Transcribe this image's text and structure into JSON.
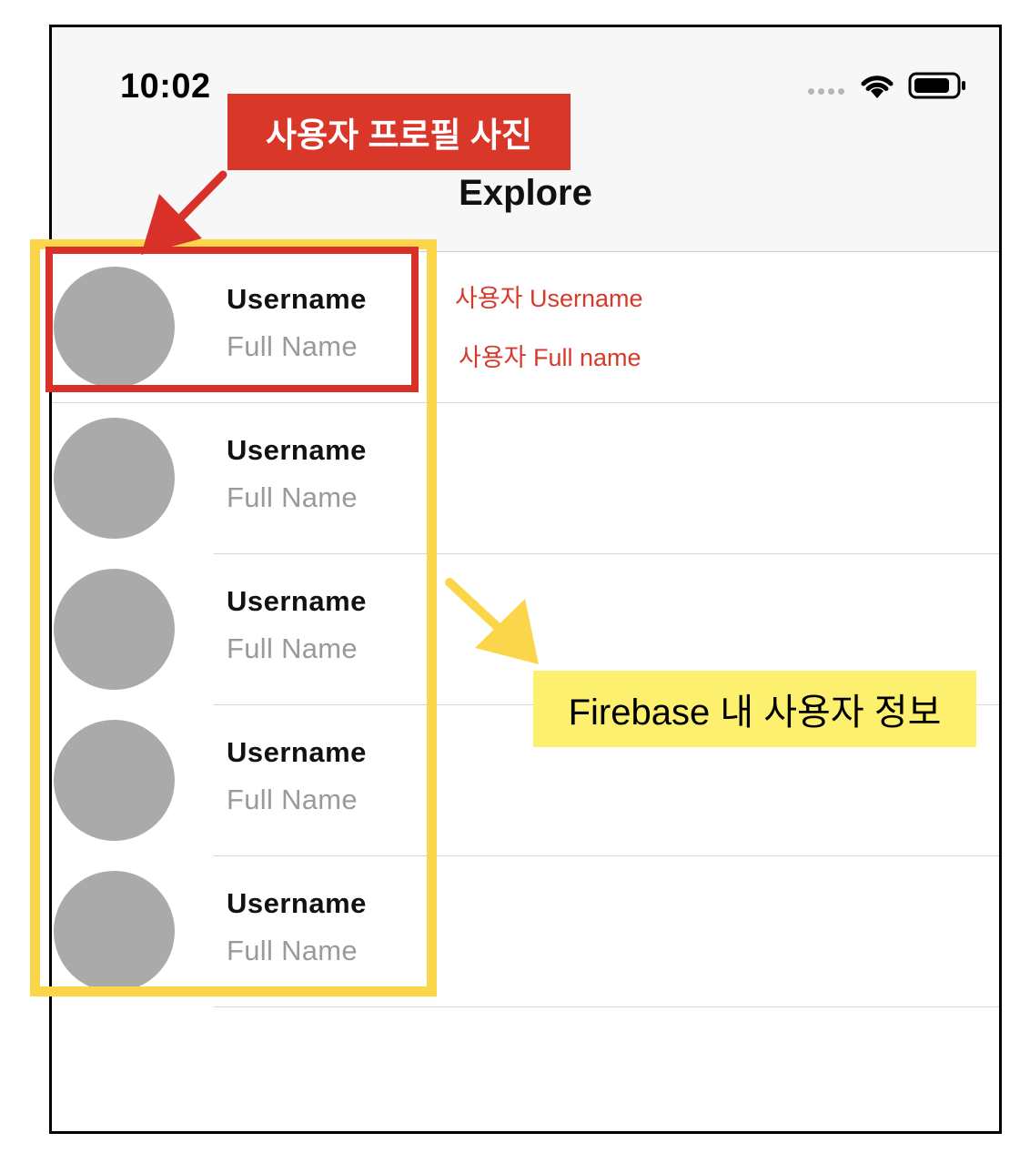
{
  "status_bar": {
    "time": "10:02"
  },
  "nav": {
    "title": "Explore"
  },
  "users": [
    {
      "username": "Username",
      "full_name": "Full Name"
    },
    {
      "username": "Username",
      "full_name": "Full Name"
    },
    {
      "username": "Username",
      "full_name": "Full Name"
    },
    {
      "username": "Username",
      "full_name": "Full Name"
    },
    {
      "username": "Username",
      "full_name": "Full Name"
    }
  ],
  "annotations": {
    "profile_photo_label": "사용자 프로필 사진",
    "username_label": "사용자 Username",
    "fullname_label": "사용자 Full name",
    "firebase_label": "Firebase 내 사용자 정보"
  },
  "colors": {
    "annotation_red": "#d9372a",
    "annotation_yellow": "#fbd64a",
    "avatar_gray": "#aaaaaa",
    "navbar_bg": "#f7f7f7"
  }
}
